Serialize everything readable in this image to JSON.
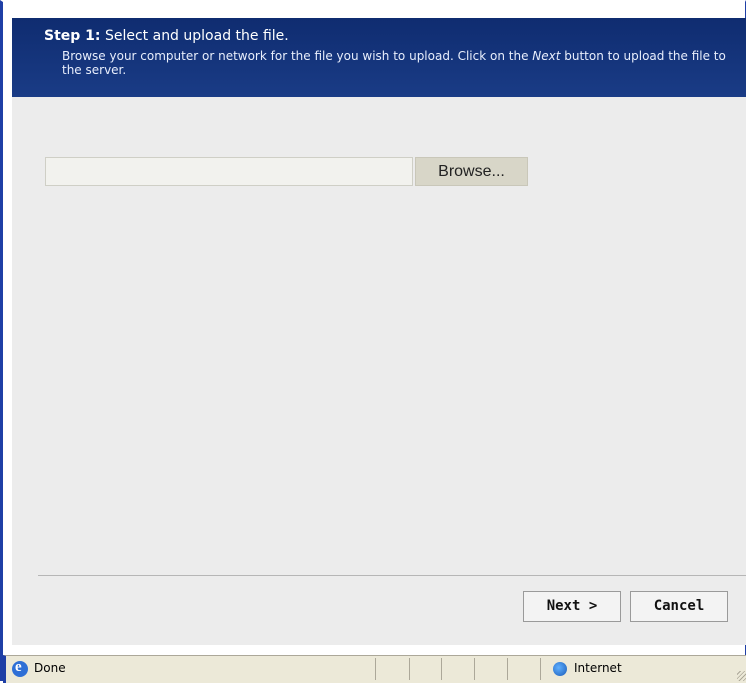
{
  "header": {
    "step_label": "Step 1:",
    "title": "Select and upload the file.",
    "description_before": "Browse your computer or network for the file you wish to upload. Click on the ",
    "description_emphasis": "Next",
    "description_after": " button to upload the file to the server."
  },
  "upload": {
    "file_value": "",
    "browse_label": "Browse..."
  },
  "footer": {
    "next_label": "Next >",
    "cancel_label": "Cancel"
  },
  "status_bar": {
    "status": "Done",
    "zone": "Internet",
    "icons": [
      "ie-icon",
      "globe-icon"
    ]
  }
}
